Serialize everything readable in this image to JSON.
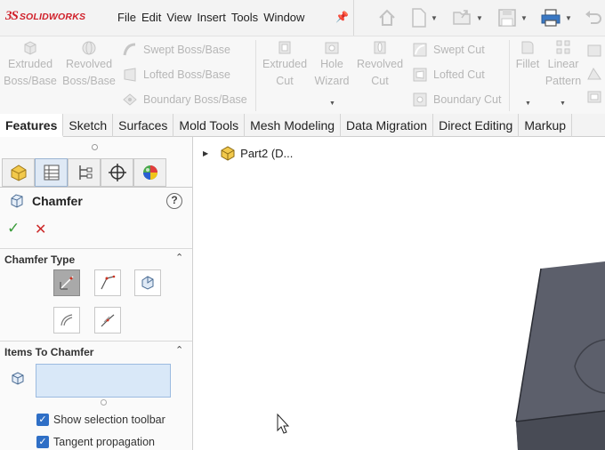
{
  "app": {
    "brand": "SOLIDWORKS",
    "brand_mark": "3S"
  },
  "menu": [
    "File",
    "Edit",
    "View",
    "Insert",
    "Tools",
    "Window"
  ],
  "ribbon": {
    "extruded_boss": [
      "Extruded",
      "Boss/Base"
    ],
    "revolved_boss": [
      "Revolved",
      "Boss/Base"
    ],
    "swept_boss": "Swept Boss/Base",
    "lofted_boss": "Lofted Boss/Base",
    "boundary_boss": "Boundary Boss/Base",
    "extruded_cut": [
      "Extruded",
      "Cut"
    ],
    "hole_wizard": [
      "Hole",
      "Wizard"
    ],
    "revolved_cut": [
      "Revolved",
      "Cut"
    ],
    "swept_cut": "Swept Cut",
    "lofted_cut": "Lofted Cut",
    "boundary_cut": "Boundary Cut",
    "fillet": "Fillet",
    "linear_pattern": [
      "Linear",
      "Pattern"
    ]
  },
  "tabs": [
    "Features",
    "Sketch",
    "Surfaces",
    "Mold Tools",
    "Mesh Modeling",
    "Data Migration",
    "Direct Editing",
    "Markup"
  ],
  "active_tab": "Features",
  "property_manager": {
    "title": "Chamfer",
    "help": "?",
    "ok": "✓",
    "cancel": "✕",
    "chamfer_type": {
      "title": "Chamfer Type",
      "caret": "⌃"
    },
    "items": {
      "title": "Items To Chamfer",
      "caret": "⌃",
      "show_selection_toolbar": "Show selection toolbar",
      "tangent_propagation": "Tangent propagation"
    }
  },
  "tree": {
    "label": "Part2 (D..."
  },
  "colors": {
    "accent": "#2f6fc6",
    "brand_red": "#d0202a",
    "ok_green": "#3a9c3a",
    "cancel_red": "#cc2a2a",
    "selection_box": "#d9e8f8"
  }
}
